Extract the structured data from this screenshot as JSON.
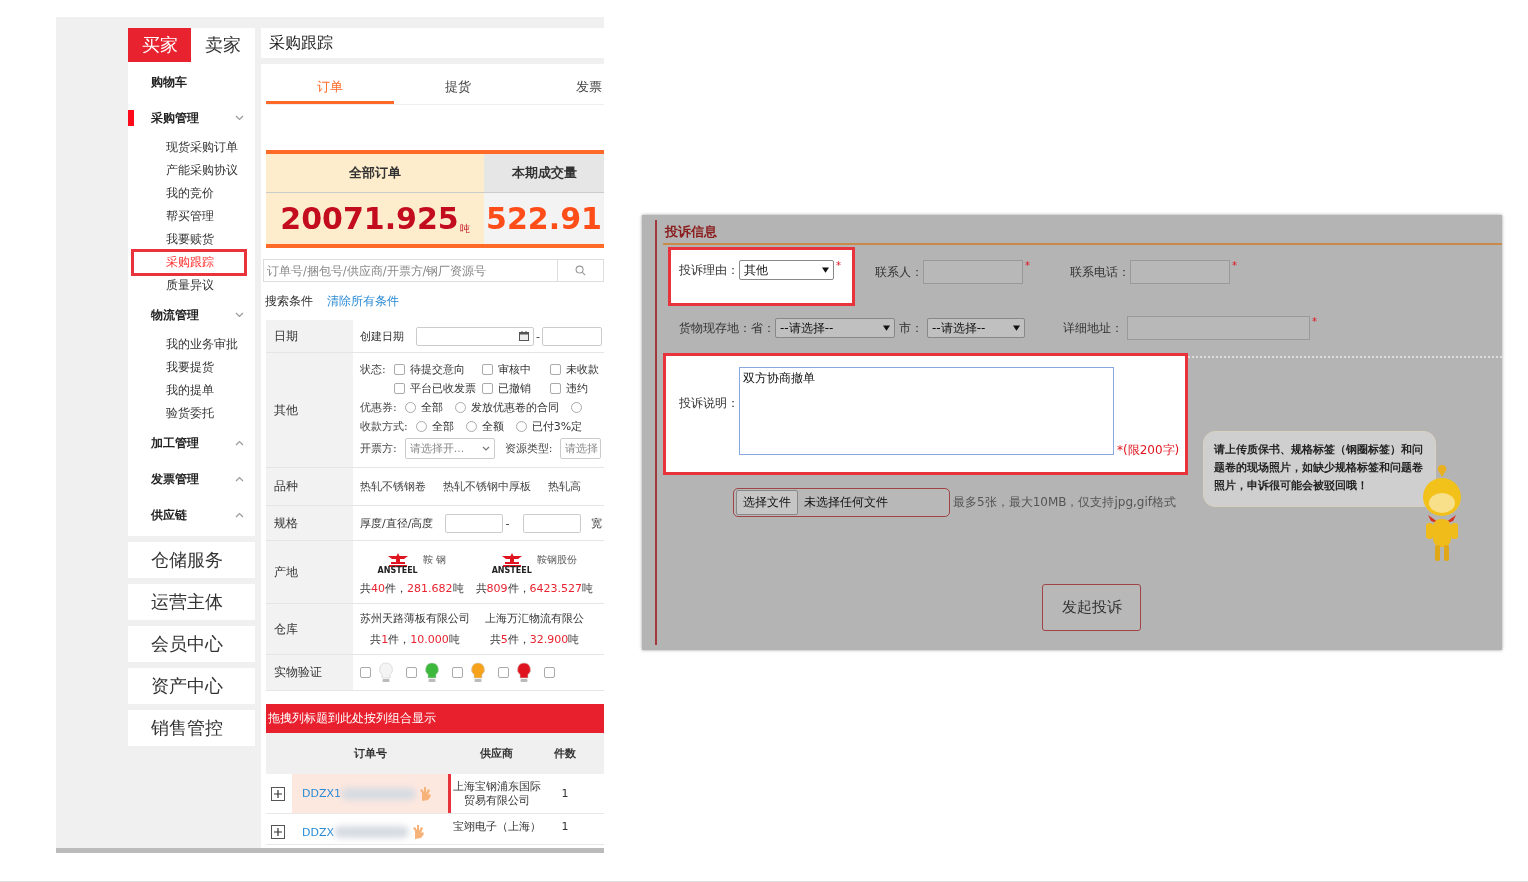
{
  "sidebar": {
    "roles": [
      {
        "label": "买家",
        "selected": true
      },
      {
        "label": "卖家",
        "selected": false
      }
    ],
    "menu": [
      {
        "kind": "link",
        "label": "购物车"
      },
      {
        "kind": "group",
        "label": "采购管理",
        "expanded": true,
        "active": true,
        "children": [
          {
            "label": "现货采购订单",
            "selected": false
          },
          {
            "label": "产能采购协议",
            "selected": false
          },
          {
            "label": "我的竞价",
            "selected": false
          },
          {
            "label": "帮买管理",
            "selected": false
          },
          {
            "label": "我要赎货",
            "selected": false
          },
          {
            "label": "采购跟踪",
            "selected": true,
            "highlighted": true
          },
          {
            "label": "质量异议",
            "selected": false
          }
        ]
      },
      {
        "kind": "group",
        "label": "物流管理",
        "expanded": true,
        "active": false,
        "children": [
          {
            "label": "我的业务审批",
            "selected": false
          },
          {
            "label": "我要提货",
            "selected": false
          },
          {
            "label": "我的提单",
            "selected": false
          },
          {
            "label": "验货委托",
            "selected": false
          }
        ]
      },
      {
        "kind": "group",
        "label": "加工管理",
        "expanded": false,
        "active": false
      },
      {
        "kind": "group",
        "label": "发票管理",
        "expanded": false,
        "active": false
      },
      {
        "kind": "group",
        "label": "供应链",
        "expanded": false,
        "active": false
      }
    ],
    "sections": [
      "仓储服务",
      "运营主体",
      "会员中心",
      "资产中心",
      "销售管控"
    ]
  },
  "main": {
    "title": "采购跟踪",
    "tabs": [
      {
        "label": "订单",
        "selected": true
      },
      {
        "label": "提货",
        "selected": false
      },
      {
        "label": "发票",
        "selected": false
      }
    ],
    "summary": [
      {
        "label": "全部订单",
        "value": "20071.925",
        "unit": "吨",
        "selected": true
      },
      {
        "label": "本期成交量",
        "value": "522.91",
        "selected": false
      }
    ],
    "search": {
      "placeholder": "订单号/捆包号/供应商/开票方/钢厂资源号"
    },
    "criteria_label": "搜索条件",
    "clear_link": "清除所有条件",
    "filters": [
      {
        "kind": "date",
        "label": "日期",
        "field_label": "创建日期",
        "separator": "-"
      },
      {
        "kind": "other",
        "label": "其他",
        "groups": [
          {
            "kind": "checks",
            "label": "状态:",
            "options": [
              {
                "label": "待提交意向",
                "checked": false
              },
              {
                "label": "审核中",
                "checked": false
              },
              {
                "label": "未收款",
                "checked": false
              },
              {
                "label": "平台已收发票",
                "checked": false
              },
              {
                "label": "已撤销",
                "checked": false
              },
              {
                "label": "违约",
                "checked": false
              }
            ]
          },
          {
            "kind": "radios",
            "label": "优惠券:",
            "options": [
              {
                "label": "全部",
                "selected": false
              },
              {
                "label": "发放优惠卷的合同",
                "selected": false
              },
              {
                "selected": false
              }
            ]
          },
          {
            "kind": "radios",
            "label": "收款方式:",
            "options": [
              {
                "label": "全部",
                "selected": false
              },
              {
                "label": "全额",
                "selected": false
              },
              {
                "label": "已付3%定",
                "selected": false
              }
            ]
          },
          {
            "kind": "selects",
            "items": [
              {
                "label": "开票方:",
                "placeholder": "请选择开..."
              },
              {
                "label": "资源类型:",
                "placeholder": "请选择"
              }
            ]
          }
        ]
      },
      {
        "kind": "tags",
        "label": "品种",
        "options": [
          "热轧不锈钢卷",
          "热轧不锈钢中厚板",
          "热轧高"
        ]
      },
      {
        "kind": "range",
        "label": "规格",
        "field_label": "厚度/直径/高度",
        "separator": "-",
        "next_label": "宽"
      },
      {
        "kind": "origins",
        "label": "产地",
        "items": [
          {
            "logo_text": "鞍 钢",
            "logo_caption": "ANSTEEL",
            "summary": [
              "共",
              "40",
              "件，",
              "281.682",
              "吨"
            ]
          },
          {
            "logo_text": "鞍钢股份",
            "logo_caption": "ANSTEEL",
            "summary": [
              "共",
              "809",
              "件，",
              "6423.527",
              "吨"
            ]
          }
        ]
      },
      {
        "kind": "warehouses",
        "label": "仓库",
        "items": [
          {
            "name": "苏州天路薄板有限公司",
            "summary": [
              "共",
              "1",
              "件，",
              "10.000",
              "吨"
            ]
          },
          {
            "name": "上海万汇物流有限公",
            "summary": [
              "共",
              "5",
              "件，",
              "32.900",
              "吨"
            ]
          }
        ]
      },
      {
        "kind": "bulbs",
        "label": "实物验证",
        "items": [
          {
            "checked": false,
            "color": "#f4f4f4"
          },
          {
            "checked": false,
            "color": "#3cb83c"
          },
          {
            "checked": false,
            "color": "#f7a21b"
          },
          {
            "checked": false,
            "color": "#e0141e"
          },
          {
            "checked": false
          }
        ]
      }
    ],
    "table": {
      "group_hint": "拖拽列标题到此处按列组合显示",
      "columns": [
        "订单号",
        "供应商",
        "件数"
      ],
      "rows": [
        {
          "order": "DDZX1",
          "supplier": "上海宝钢浦东国际贸易有限公司",
          "count": "1",
          "highlighted": true
        },
        {
          "order": "DDZX",
          "supplier": "宝翊电子（上海）",
          "count": "1",
          "highlighted": false
        }
      ]
    }
  },
  "complaint": {
    "title": "投诉信息",
    "fields": [
      {
        "kind": "select",
        "label": "投诉理由：",
        "value": "其他",
        "required_mark": "*",
        "highlighted": true
      },
      {
        "kind": "input",
        "label": "联系人：",
        "required_mark": "*",
        "highlighted": false
      },
      {
        "kind": "input",
        "label": "联系电话：",
        "required_mark": "*",
        "highlighted": false
      }
    ],
    "location": {
      "label": "货物现存地：省：",
      "province": "--请选择--",
      "city_label": "市：",
      "city": "--请选择--",
      "address_label": "详细地址：",
      "required_mark": "*"
    },
    "description": {
      "label": "投诉说明：",
      "value": "双方协商撤单",
      "limit": "*(限200字)",
      "highlighted": true
    },
    "upload": {
      "button": "选择文件",
      "status": "未选择任何文件",
      "hint": "最多5张，最大10MB，仅支持jpg,gif格式"
    },
    "submit": "发起投诉",
    "tip": "请上传质保书、规格标签（钢圈标签）和问题卷的现场照片，如缺少规格标签和问题卷照片，申诉很可能会被驳回哦！"
  }
}
